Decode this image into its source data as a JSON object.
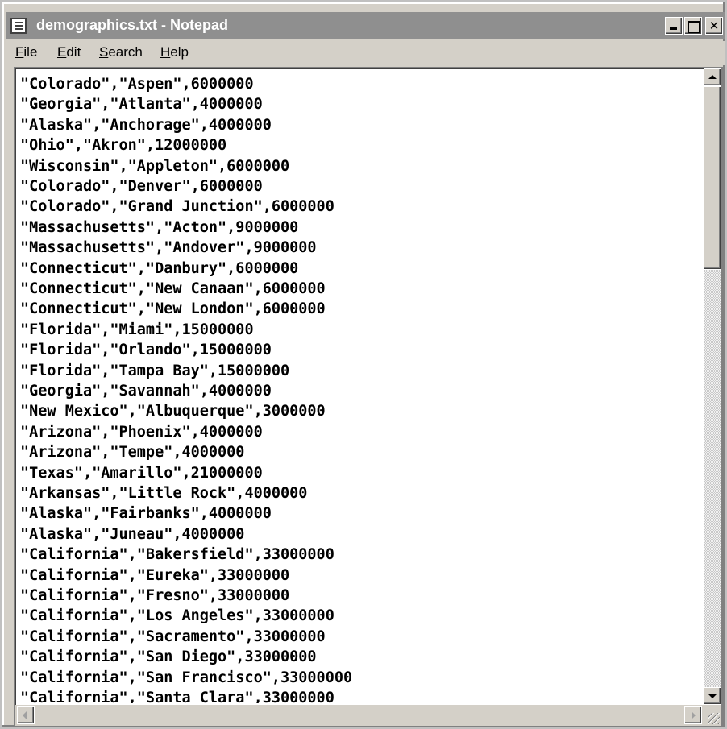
{
  "window": {
    "title": "demographics.txt - Notepad"
  },
  "caption_buttons": {
    "minimize_icon": "minimize-icon",
    "maximize_icon": "maximize-icon",
    "close_icon": "close-icon",
    "close_label": "✕"
  },
  "menu": {
    "items": [
      "File",
      "Edit",
      "Search",
      "Help"
    ]
  },
  "document": {
    "lines": [
      "\"Colorado\",\"Aspen\",6000000",
      "\"Georgia\",\"Atlanta\",4000000",
      "\"Alaska\",\"Anchorage\",4000000",
      "\"Ohio\",\"Akron\",12000000",
      "\"Wisconsin\",\"Appleton\",6000000",
      "\"Colorado\",\"Denver\",6000000",
      "\"Colorado\",\"Grand Junction\",6000000",
      "\"Massachusetts\",\"Acton\",9000000",
      "\"Massachusetts\",\"Andover\",9000000",
      "\"Connecticut\",\"Danbury\",6000000",
      "\"Connecticut\",\"New Canaan\",6000000",
      "\"Connecticut\",\"New London\",6000000",
      "\"Florida\",\"Miami\",15000000",
      "\"Florida\",\"Orlando\",15000000",
      "\"Florida\",\"Tampa Bay\",15000000",
      "\"Georgia\",\"Savannah\",4000000",
      "\"New Mexico\",\"Albuquerque\",3000000",
      "\"Arizona\",\"Phoenix\",4000000",
      "\"Arizona\",\"Tempe\",4000000",
      "\"Texas\",\"Amarillo\",21000000",
      "\"Arkansas\",\"Little Rock\",4000000",
      "\"Alaska\",\"Fairbanks\",4000000",
      "\"Alaska\",\"Juneau\",4000000",
      "\"California\",\"Bakersfield\",33000000",
      "\"California\",\"Eureka\",33000000",
      "\"California\",\"Fresno\",33000000",
      "\"California\",\"Los Angeles\",33000000",
      "\"California\",\"Sacramento\",33000000",
      "\"California\",\"San Diego\",33000000",
      "\"California\",\"San Francisco\",33000000",
      "\"California\",\"Santa Clara\",33000000"
    ]
  },
  "colors": {
    "titlebar_inactive": "#8f8f8f",
    "face": "#d4d0c8",
    "text": "#000000",
    "background": "#ffffff"
  }
}
